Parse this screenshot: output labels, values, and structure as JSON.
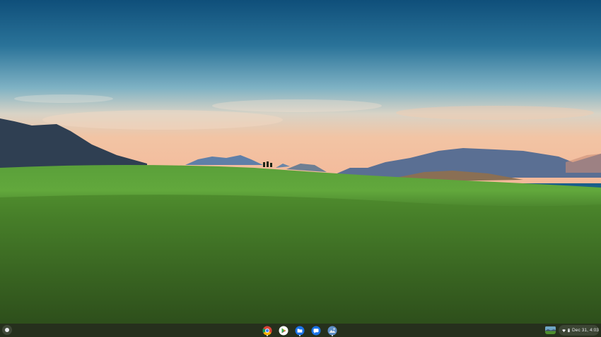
{
  "wallpaper": {
    "description_icon": "landscape-wallpaper",
    "colors": {
      "sky_top": "#13557f",
      "sky_mid": "#5c9fb8",
      "sky_horizon": "#f1c9a8",
      "mountain": "#3c4f6e",
      "grass_bright": "#5fa236",
      "grass_dark": "#2c4a18"
    }
  },
  "shelf": {
    "launcher_icon": "launcher-circle-icon",
    "apps": [
      {
        "name": "chrome",
        "icon": "chrome-icon",
        "running": true
      },
      {
        "name": "play-store",
        "icon": "play-store-icon",
        "running": false
      },
      {
        "name": "files",
        "icon": "files-icon",
        "running": true
      },
      {
        "name": "messages",
        "icon": "messages-icon",
        "running": false
      },
      {
        "name": "gallery",
        "icon": "gallery-icon",
        "running": true
      }
    ],
    "status": {
      "wifi_icon": "wifi-icon",
      "battery_icon": "battery-icon",
      "datetime": "Dec 31, 4:03"
    }
  }
}
